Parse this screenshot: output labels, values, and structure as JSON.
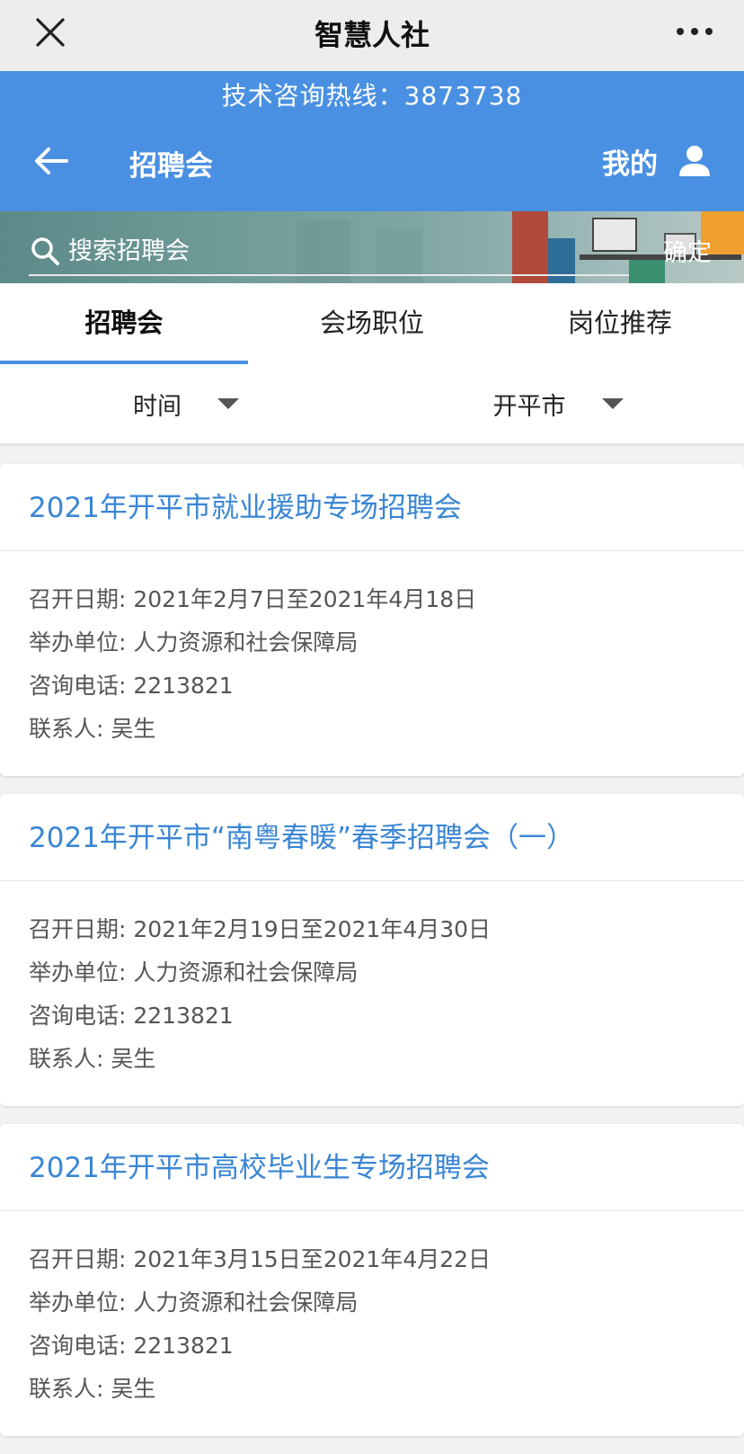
{
  "wechat": {
    "title": "智慧人社"
  },
  "header": {
    "hotline": "技术咨询热线：3873738",
    "title": "招聘会",
    "mine_label": "我的"
  },
  "search": {
    "placeholder": "搜索招聘会",
    "confirm_label": "确定"
  },
  "tabs": [
    {
      "label": "招聘会",
      "active": true
    },
    {
      "label": "会场职位",
      "active": false
    },
    {
      "label": "岗位推荐",
      "active": false
    }
  ],
  "filters": [
    {
      "label": "时间"
    },
    {
      "label": "开平市"
    }
  ],
  "fairs": [
    {
      "title": "2021年开平市就业援助专场招聘会",
      "date": "召开日期: 2021年2月7日至2021年4月18日",
      "organizer": "举办单位: 人力资源和社会保障局",
      "phone": "咨询电话: 2213821",
      "contact": "联系人: 吴生"
    },
    {
      "title": "2021年开平市“南粤春暖”春季招聘会（一）",
      "date": "召开日期: 2021年2月19日至2021年4月30日",
      "organizer": "举办单位: 人力资源和社会保障局",
      "phone": "咨询电话: 2213821",
      "contact": "联系人: 吴生"
    },
    {
      "title": "2021年开平市高校毕业生专场招聘会",
      "date": "召开日期: 2021年3月15日至2021年4月22日",
      "organizer": "举办单位: 人力资源和社会保障局",
      "phone": "咨询电话: 2213821",
      "contact": "联系人: 吴生"
    }
  ],
  "colors": {
    "header_blue": "#4a90e2",
    "title_blue": "#3a86d4"
  }
}
